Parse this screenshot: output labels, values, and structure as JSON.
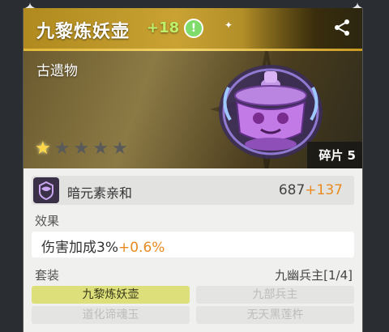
{
  "header": {
    "title": "九黎炼妖壶",
    "level": "+18",
    "alert_symbol": "!"
  },
  "hero": {
    "category": "古遗物",
    "stars_filled": 1,
    "stars_total": 5,
    "fragment": "碎片 5"
  },
  "stat": {
    "name": "暗元素亲和",
    "base": "687",
    "bonus": "+137"
  },
  "effect": {
    "label": "效果",
    "text": "伤害加成3%",
    "bonus": "+0.6%"
  },
  "set": {
    "label": "套装",
    "name_count": "九幽兵主[1/4]",
    "items": [
      {
        "name": "九黎炼妖壶",
        "active": true
      },
      {
        "name": "九部兵主",
        "active": false
      },
      {
        "name": "道化谛魂玉",
        "active": false
      },
      {
        "name": "无天黑莲杵",
        "active": false
      }
    ]
  },
  "colors": {
    "header_gold": "#c9a233",
    "level_green": "#bff06a",
    "bonus_orange": "#e88a20",
    "set_active": "#dde07a"
  },
  "icons": [
    "corner-star-icon",
    "alert-icon",
    "sparkle-icon",
    "share-icon",
    "star-icon",
    "dark-element-icon",
    "relic-pot-icon"
  ]
}
